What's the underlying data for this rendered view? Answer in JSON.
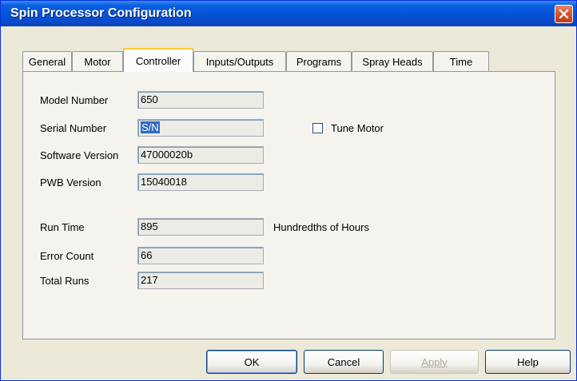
{
  "window": {
    "title": "Spin Processor Configuration"
  },
  "tabs": [
    {
      "label": "General",
      "active": false
    },
    {
      "label": "Motor",
      "active": false
    },
    {
      "label": "Controller",
      "active": true
    },
    {
      "label": "Inputs/Outputs",
      "active": false
    },
    {
      "label": "Programs",
      "active": false
    },
    {
      "label": "Spray Heads",
      "active": false
    },
    {
      "label": "Time",
      "active": false
    }
  ],
  "controller": {
    "model_number": {
      "label": "Model Number",
      "value": "650"
    },
    "serial_number": {
      "label": "Serial Number",
      "value": "S/N"
    },
    "software_version": {
      "label": "Software Version",
      "value": "47000020b"
    },
    "pwb_version": {
      "label": "PWB Version",
      "value": "15040018"
    },
    "tune_motor": {
      "label": "Tune Motor",
      "checked": false
    },
    "run_time": {
      "label": "Run Time",
      "value": "895",
      "units": "Hundredths of Hours"
    },
    "error_count": {
      "label": "Error Count",
      "value": "66"
    },
    "total_runs": {
      "label": "Total Runs",
      "value": "217"
    }
  },
  "buttons": {
    "ok": "OK",
    "cancel": "Cancel",
    "apply": "Apply",
    "help": "Help"
  },
  "icons": {
    "close": "close-icon"
  },
  "colors": {
    "titlebar": "#0553d8",
    "close_button": "#d9552d",
    "active_tab_accent": "#ffc83c",
    "selection": "#316ac5",
    "dialog_background": "#ece9d8"
  }
}
